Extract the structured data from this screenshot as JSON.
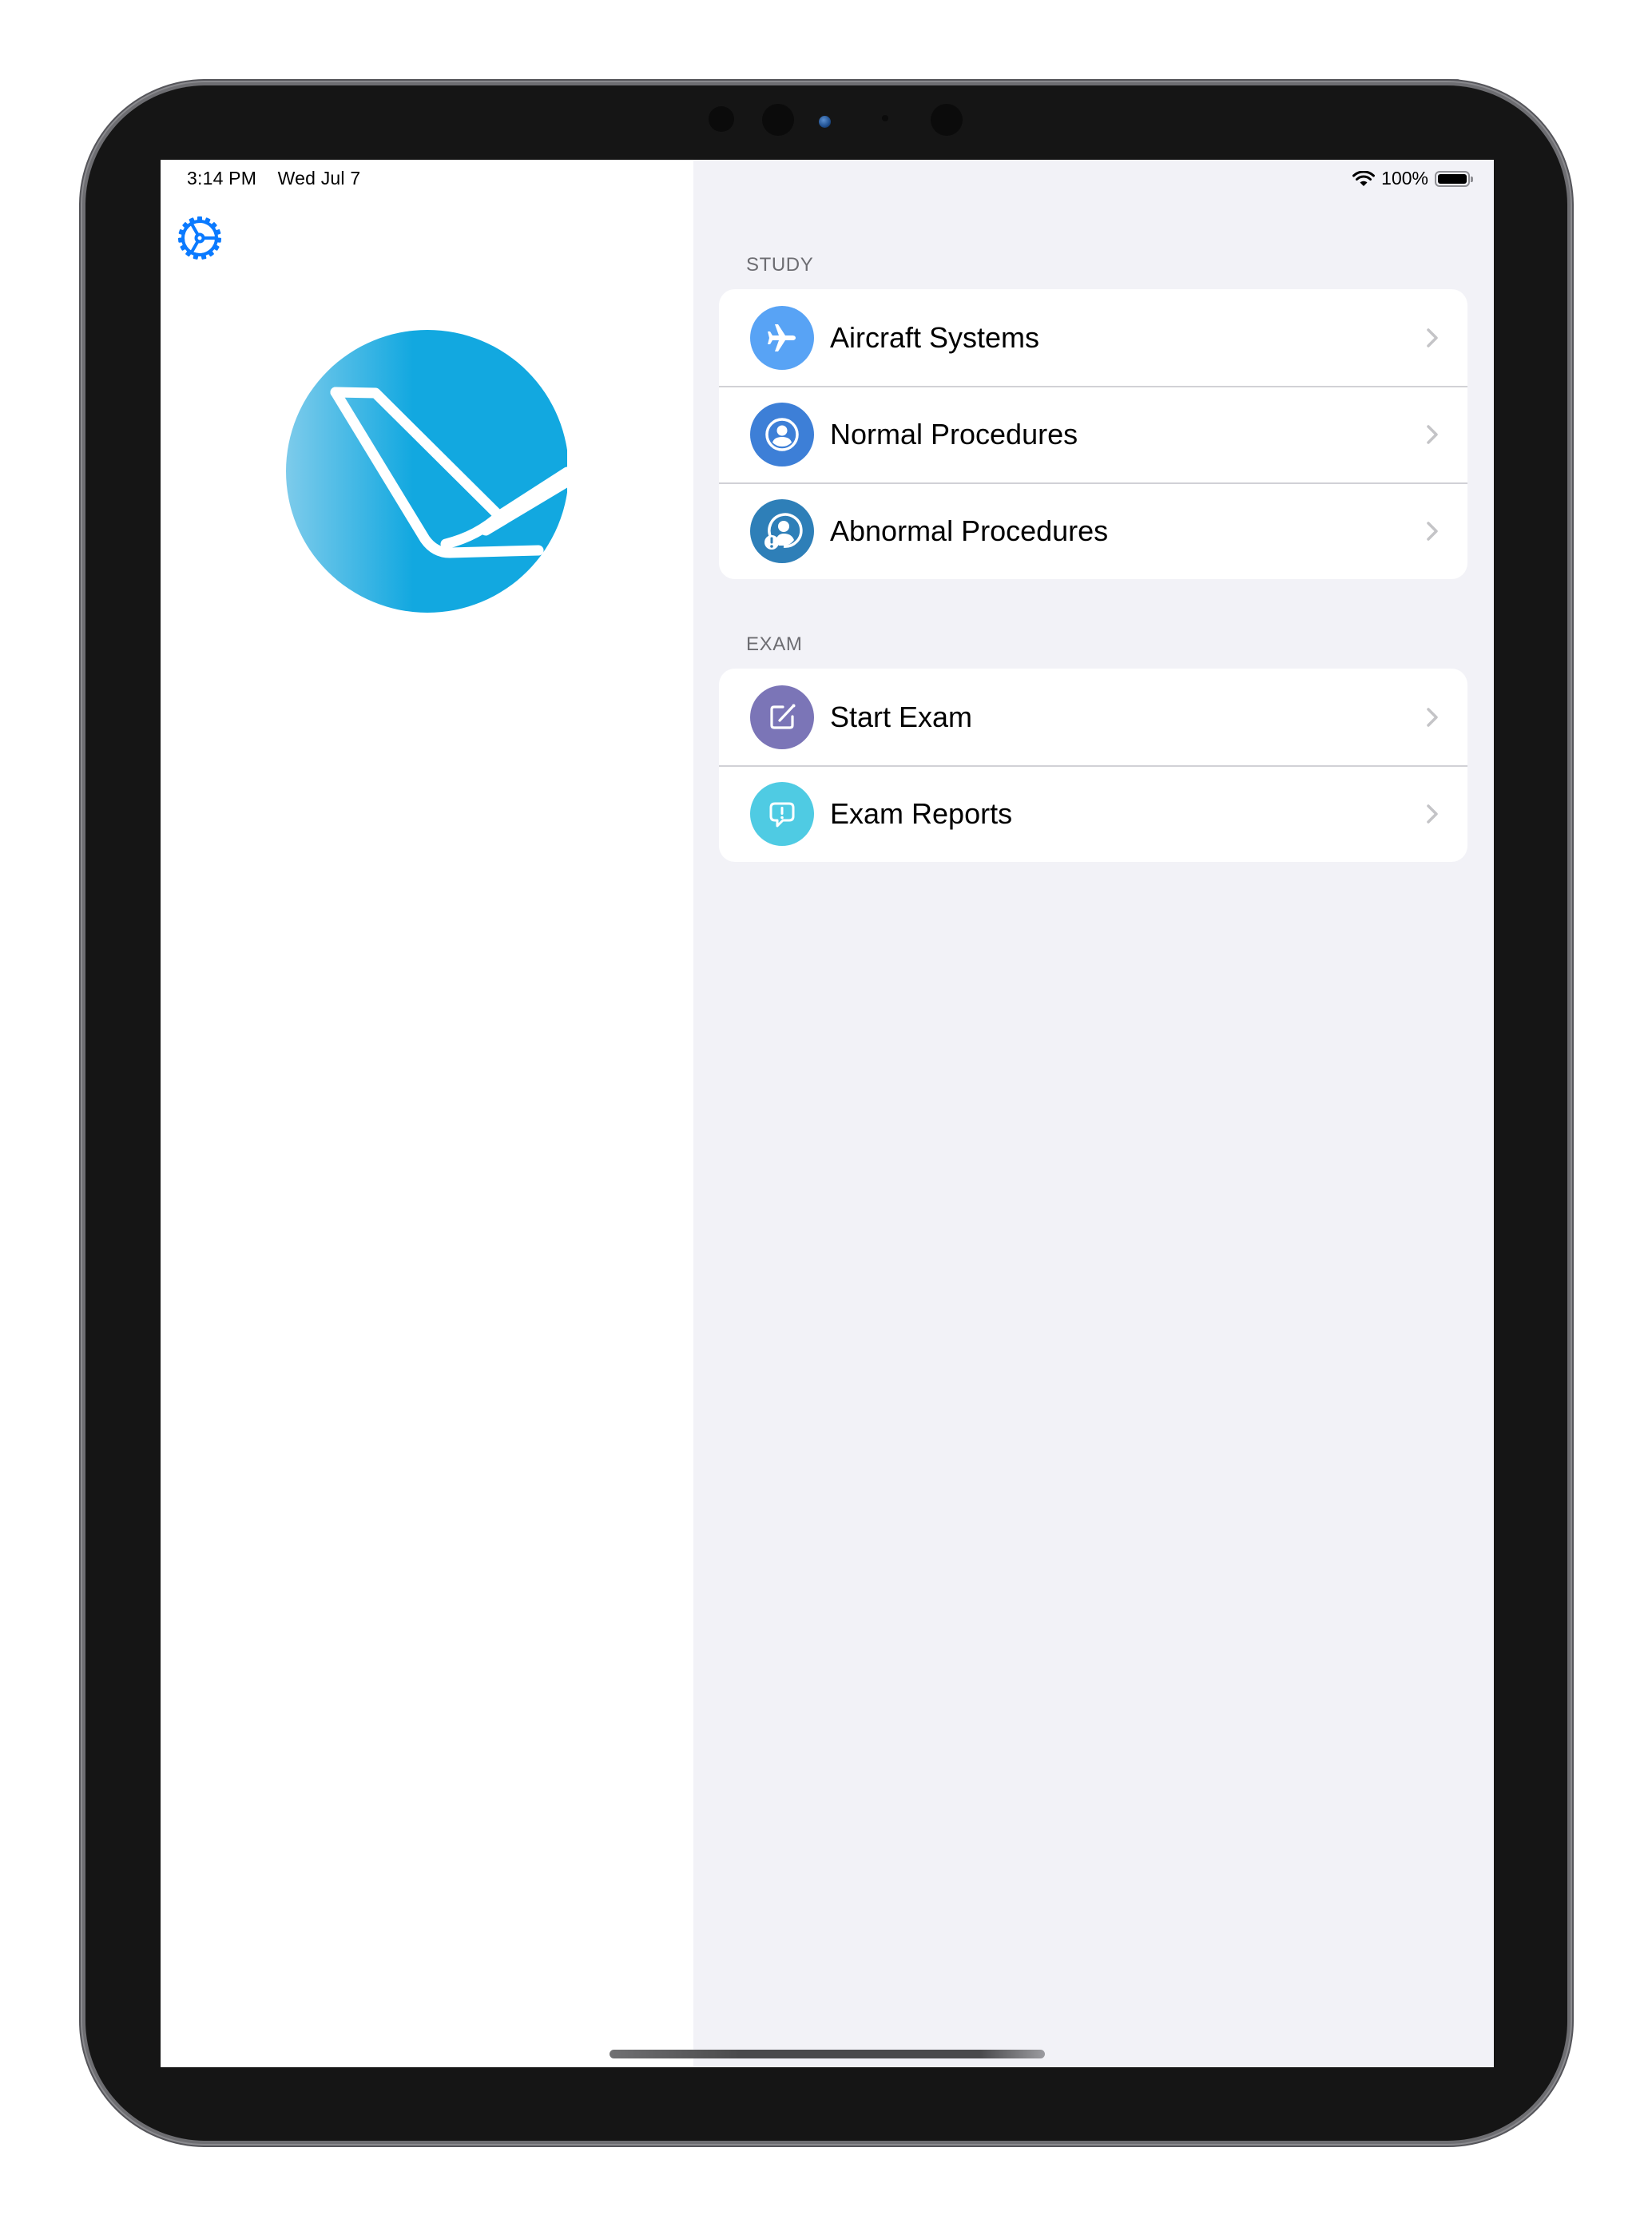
{
  "status_bar": {
    "time": "3:14 PM",
    "date": "Wed Jul 7",
    "battery_text": "100%",
    "battery_level": 1.0
  },
  "sidebar": {
    "settings_icon": "gear-icon",
    "logo": "app-logo-plane-tail"
  },
  "sections": [
    {
      "header": "STUDY",
      "items": [
        {
          "label": "Aircraft Systems",
          "icon": "airplane-icon",
          "color": "#58a3f5"
        },
        {
          "label": "Normal Procedures",
          "icon": "person-circle-icon",
          "color": "#3d7fd7"
        },
        {
          "label": "Abnormal Procedures",
          "icon": "person-alert-icon",
          "color": "#2e7fb8"
        }
      ]
    },
    {
      "header": "EXAM",
      "items": [
        {
          "label": "Start Exam",
          "icon": "compose-icon",
          "color": "#7b75b7"
        },
        {
          "label": "Exam Reports",
          "icon": "alert-bubble-icon",
          "color": "#4fcbe3"
        }
      ]
    }
  ],
  "colors": {
    "accent": "#0a7aff",
    "logo_blue": "#12a8e0",
    "group_background": "#f2f2f7"
  }
}
